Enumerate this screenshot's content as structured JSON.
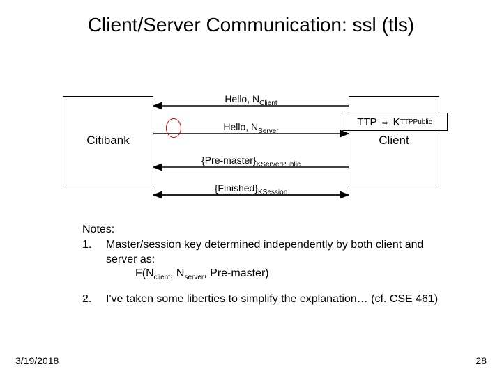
{
  "title": "Client/Server Communication: ssl (tls)",
  "left_box": "Citibank",
  "right_box": "Client",
  "ttp_html": "TTP ⇔ K<span class=\"sub\">TTPPublic</span>",
  "messages": {
    "m1_html": "Hello, N<span class=\"sub\">Client</span>",
    "m2_html": "Hello, N<span class=\"sub\">Server</span>",
    "m3_html": "{Pre-master}<span class=\"sub\">KServerPublic</span>",
    "m4_html": "{Finished}<span class=\"sub\">KSession</span>"
  },
  "notes": {
    "heading": "Notes:",
    "items": [
      {
        "num": "1.",
        "body_html": "Master/session key determined independently by both client and server as:<div class=\"indent\">F(N<span class=\"sub\">client</span>, N<span class=\"sub\">server</span>, Pre-master)</div>"
      },
      {
        "num": "2.",
        "body_html": "I've taken some liberties to simplify the explanation… (cf. CSE 461)"
      }
    ]
  },
  "footer": {
    "date": "3/19/2018",
    "page": "28"
  }
}
